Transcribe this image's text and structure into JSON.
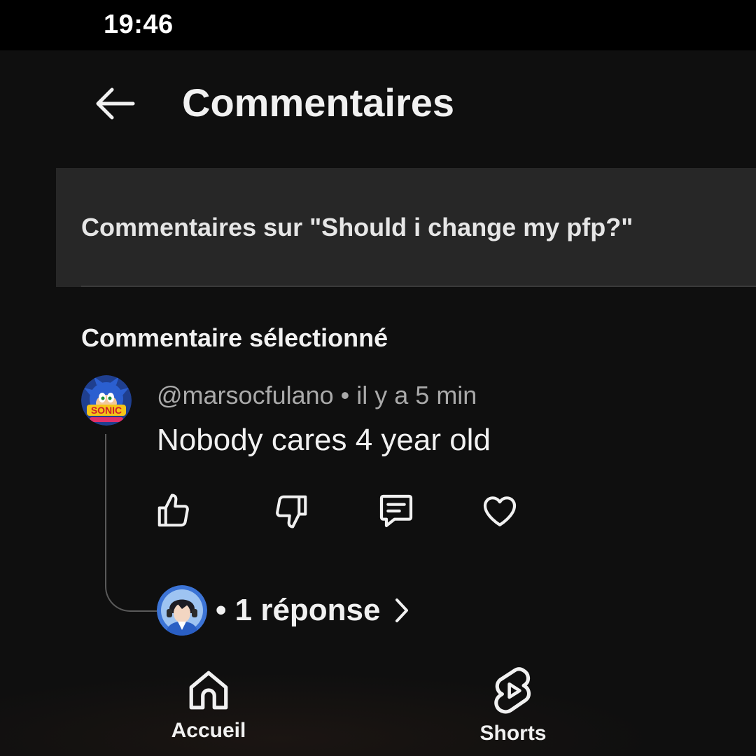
{
  "status_bar": {
    "time": "19:46"
  },
  "header": {
    "title": "Commentaires"
  },
  "context": {
    "text": "Commentaires sur \"Should i change my pfp?\""
  },
  "section": {
    "label": "Commentaire sélectionné"
  },
  "comment": {
    "author": "@marsocfulano",
    "separator": " • ",
    "time": "il y a 5 min",
    "text": "Nobody cares 4 year old",
    "avatar_text": "SONIC"
  },
  "actions": {
    "like_icon": "thumbs-up-icon",
    "dislike_icon": "thumbs-down-icon",
    "reply_icon": "comment-icon",
    "heart_icon": "heart-icon"
  },
  "replies": {
    "label": "• 1 réponse"
  },
  "nav": {
    "items": [
      {
        "label": "Accueil",
        "icon": "home-icon"
      },
      {
        "label": "Shorts",
        "icon": "shorts-icon"
      }
    ]
  },
  "colors": {
    "background": "#0f0f0f",
    "banner": "#272727",
    "text_primary": "#f1f1f1",
    "text_secondary": "#aaaaaa"
  }
}
